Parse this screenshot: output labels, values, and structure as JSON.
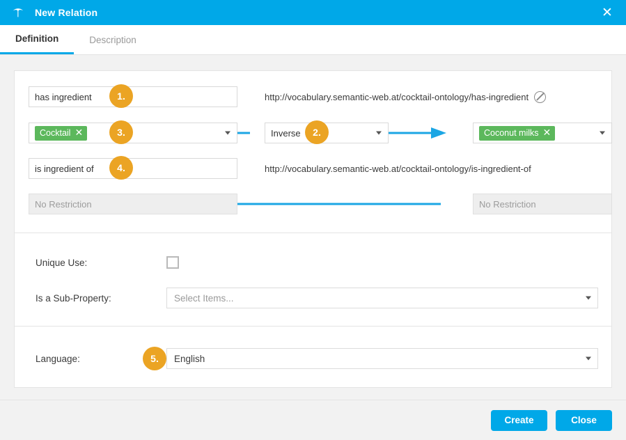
{
  "window": {
    "title": "New Relation",
    "logo_icon": "poolparty-logo-icon",
    "close_icon": "close-icon"
  },
  "tabs": [
    {
      "label": "Definition",
      "active": true
    },
    {
      "label": "Description",
      "active": false
    }
  ],
  "relation": {
    "forward": {
      "label_value": "has ingredient",
      "uri": "http://vocabulary.semantic-web.at/cocktail-ontology/has-ingredient",
      "uri_icon": "no-edit-icon",
      "domain_tag": "Cocktail",
      "domain_tag_remove_icon": "remove-tag-icon",
      "relation_type": "Inverse",
      "range_tag": "Coconut milks",
      "range_tag_remove_icon": "remove-tag-icon"
    },
    "inverse": {
      "label_value": "is ingredient of",
      "uri": "http://vocabulary.semantic-web.at/cocktail-ontology/is-ingredient-of",
      "domain_restriction": "No Restriction",
      "range_restriction": "No Restriction"
    },
    "badges": [
      {
        "text": "1."
      },
      {
        "text": "2."
      },
      {
        "text": "3."
      },
      {
        "text": "4."
      },
      {
        "text": "5."
      }
    ]
  },
  "options": {
    "unique_use_label": "Unique Use:",
    "unique_use_checked": false,
    "sub_property_label": "Is a Sub-Property:",
    "sub_property_placeholder": "Select Items...",
    "language_label": "Language:",
    "language_value": "English"
  },
  "footer": {
    "create_label": "Create",
    "close_label": "Close"
  },
  "colors": {
    "accent": "#00a8e8",
    "badge": "#eba424",
    "tag_green": "#5cb85c",
    "arrow_blue": "#1ba6e4"
  }
}
